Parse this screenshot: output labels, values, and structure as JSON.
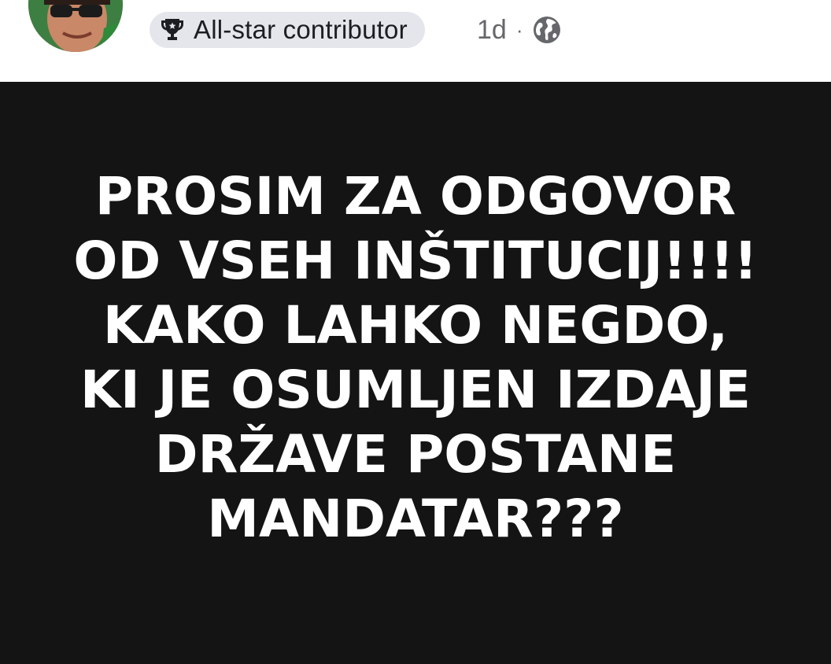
{
  "header": {
    "avatar_icon": "profile-photo",
    "badge": {
      "icon": "trophy-icon",
      "label": "All-star contributor"
    },
    "time": "1d",
    "separator": "·",
    "privacy_icon": "globe-icon"
  },
  "post": {
    "background_color": "#141414",
    "text_color": "#ffffff",
    "lines": [
      "PROSIM ZA ODGOVOR",
      "OD VSEH INŠTITUCIJ!!!!",
      "KAKO LAHKO NEGDO,",
      "KI JE OSUMLJEN IZDAJE",
      "DRŽAVE POSTANE",
      "MANDATAR???"
    ]
  }
}
